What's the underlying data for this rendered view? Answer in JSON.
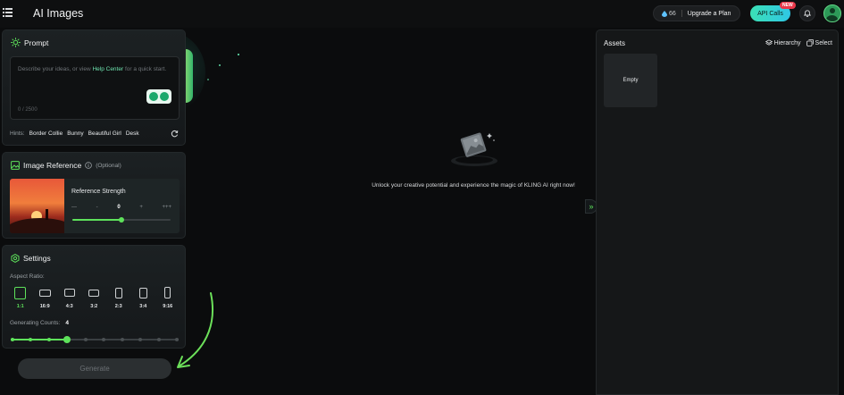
{
  "header": {
    "title": "AI Images",
    "credits": "66",
    "upgrade_label": "Upgrade a Plan",
    "api_label": "API Calls",
    "new_badge": "NEW"
  },
  "prompt": {
    "title": "Prompt",
    "placeholder_before": "Describe your ideas, or view ",
    "help_link": "Help Center",
    "placeholder_after": " for a quick start.",
    "char_count": "0 / 2500",
    "hints_label": "Hints:",
    "hints": [
      "Border Collie",
      "Bunny",
      "Beautiful Girl",
      "Desk"
    ]
  },
  "image_reference": {
    "title": "Image Reference",
    "optional": "(Optional)",
    "strength_label": "Reference Strength",
    "ticks": [
      "—",
      "-",
      "0",
      "+",
      "+++"
    ],
    "strength_level": 0.5
  },
  "settings": {
    "title": "Settings",
    "aspect_label": "Aspect Ratio:",
    "ratios": [
      "1:1",
      "16:9",
      "4:3",
      "3:2",
      "2:3",
      "3:4",
      "9:16"
    ],
    "selected_ratio": "1:1",
    "count_label": "Generating Counts:",
    "count_value": "4",
    "count_max": 10
  },
  "generate_label": "Generate",
  "main": {
    "empty_message": "Unlock your creative potential and experience the magic of KLING AI right now!"
  },
  "assets": {
    "title": "Assets",
    "hierarchy_label": "Hierarchy",
    "select_label": "Select",
    "empty_label": "Empty"
  },
  "colors": {
    "accent": "#5ee25b",
    "link": "#6fe5b0",
    "background": "#0b0c0d"
  }
}
